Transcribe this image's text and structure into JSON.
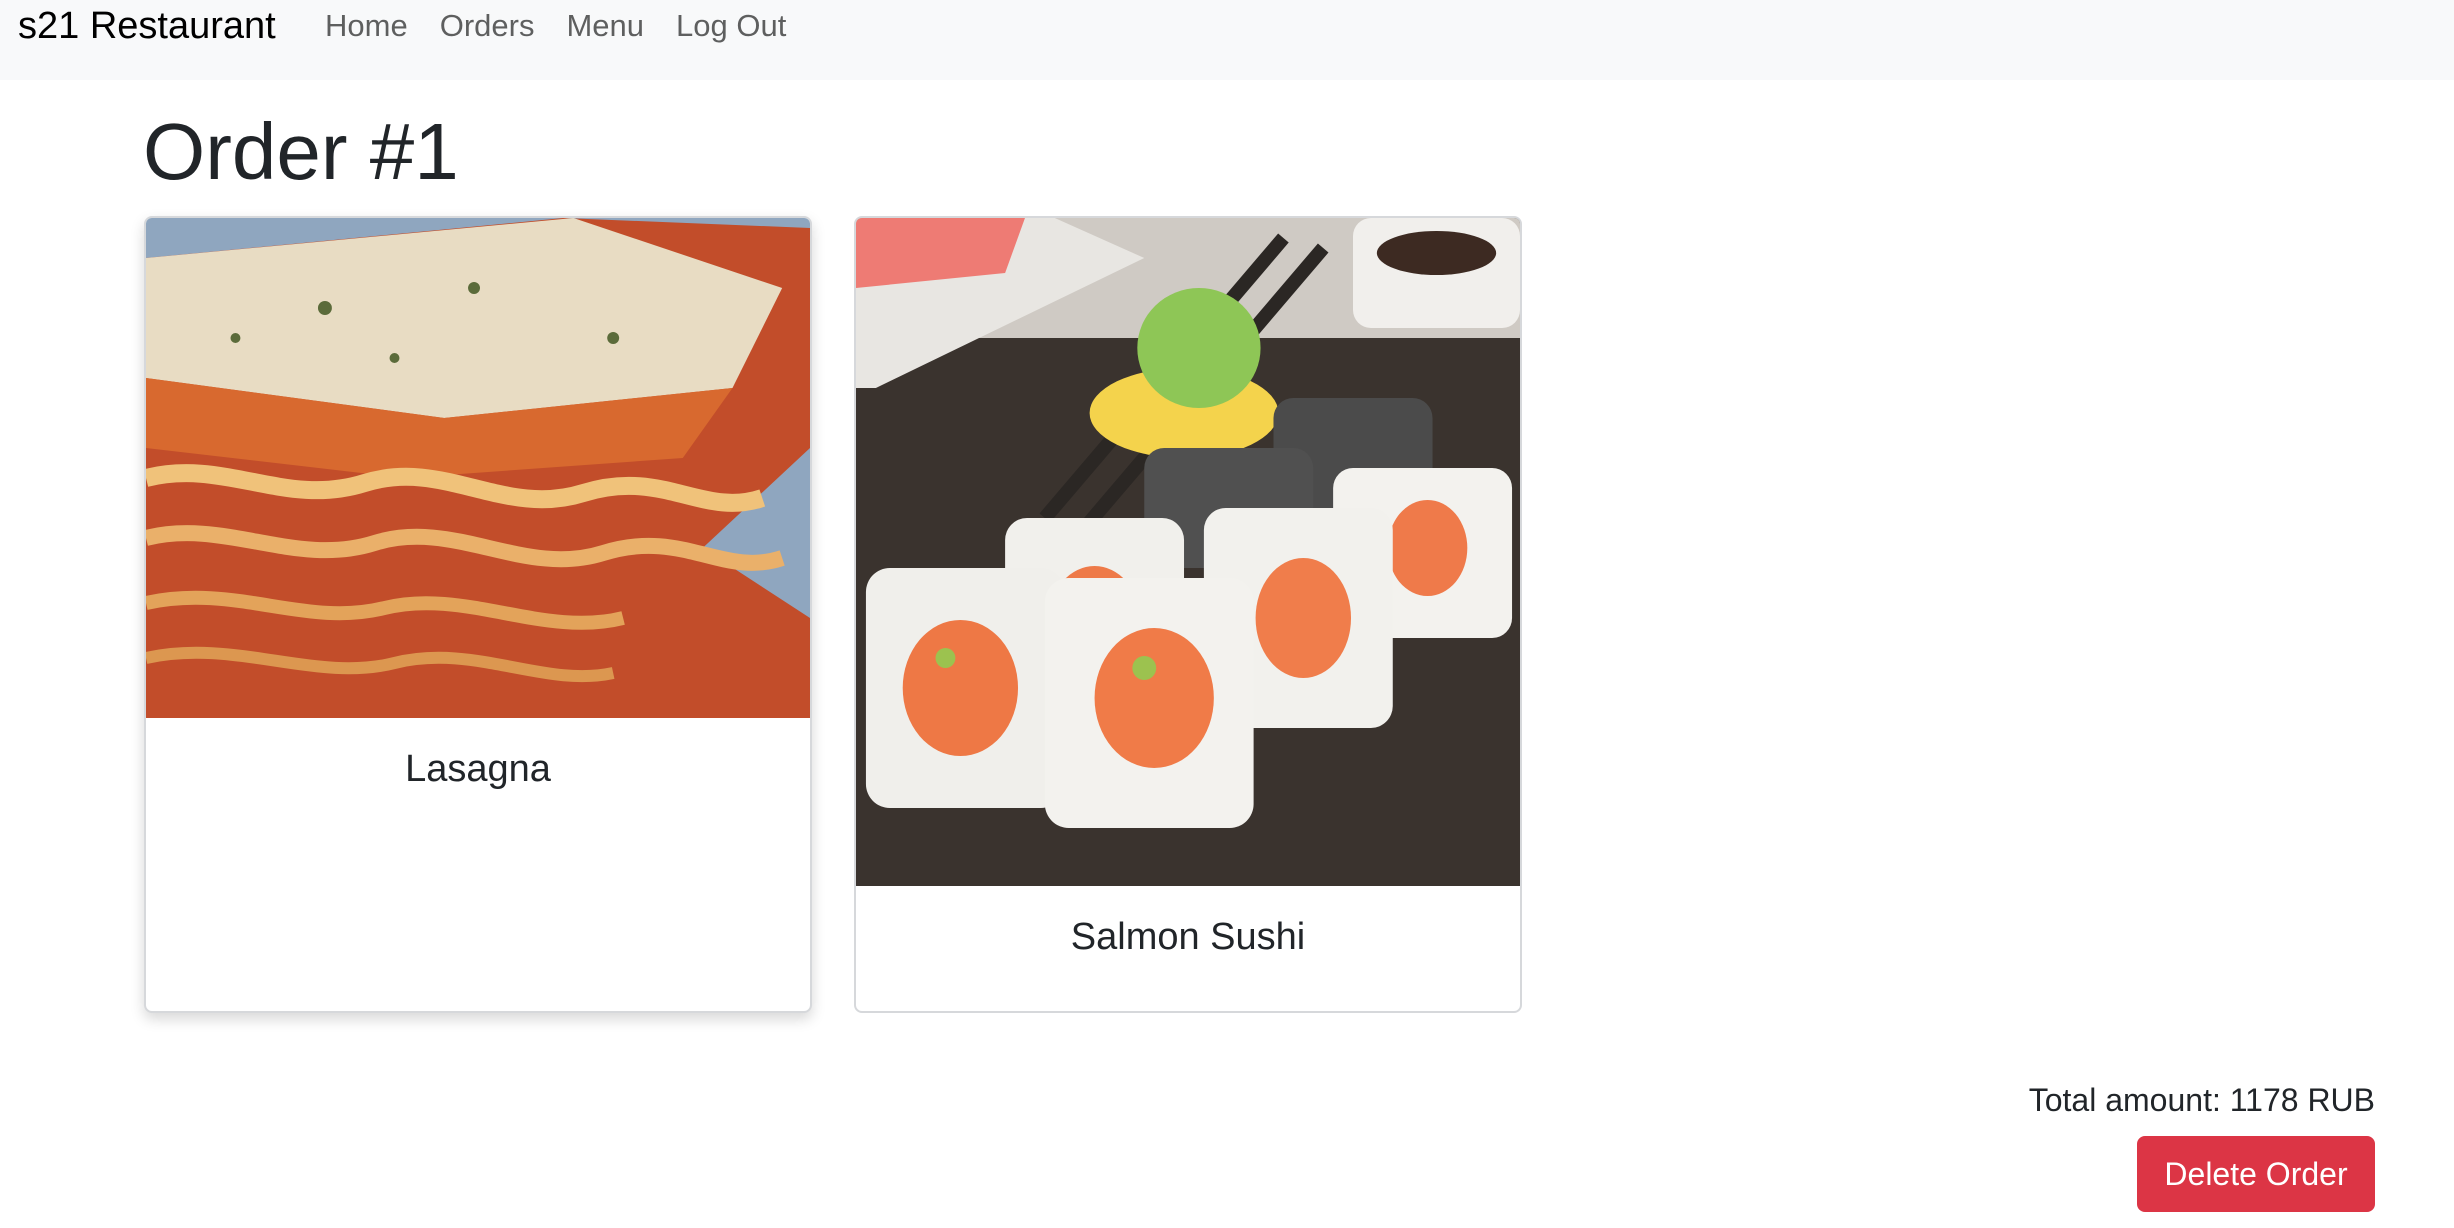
{
  "navbar": {
    "brand": "s21 Restaurant",
    "links": [
      {
        "label": "Home"
      },
      {
        "label": "Orders"
      },
      {
        "label": "Menu"
      },
      {
        "label": "Log Out"
      }
    ]
  },
  "order": {
    "title": "Order #1",
    "items": [
      {
        "name": "Lasagna",
        "image": "lasagna-photo"
      },
      {
        "name": "Salmon Sushi",
        "image": "salmon-sushi-photo"
      }
    ],
    "total_label": "Total amount: 1178 RUB",
    "delete_label": "Delete Order"
  },
  "colors": {
    "navbar_bg": "#f8f9fa",
    "danger": "#dc3545",
    "text": "#212529"
  }
}
